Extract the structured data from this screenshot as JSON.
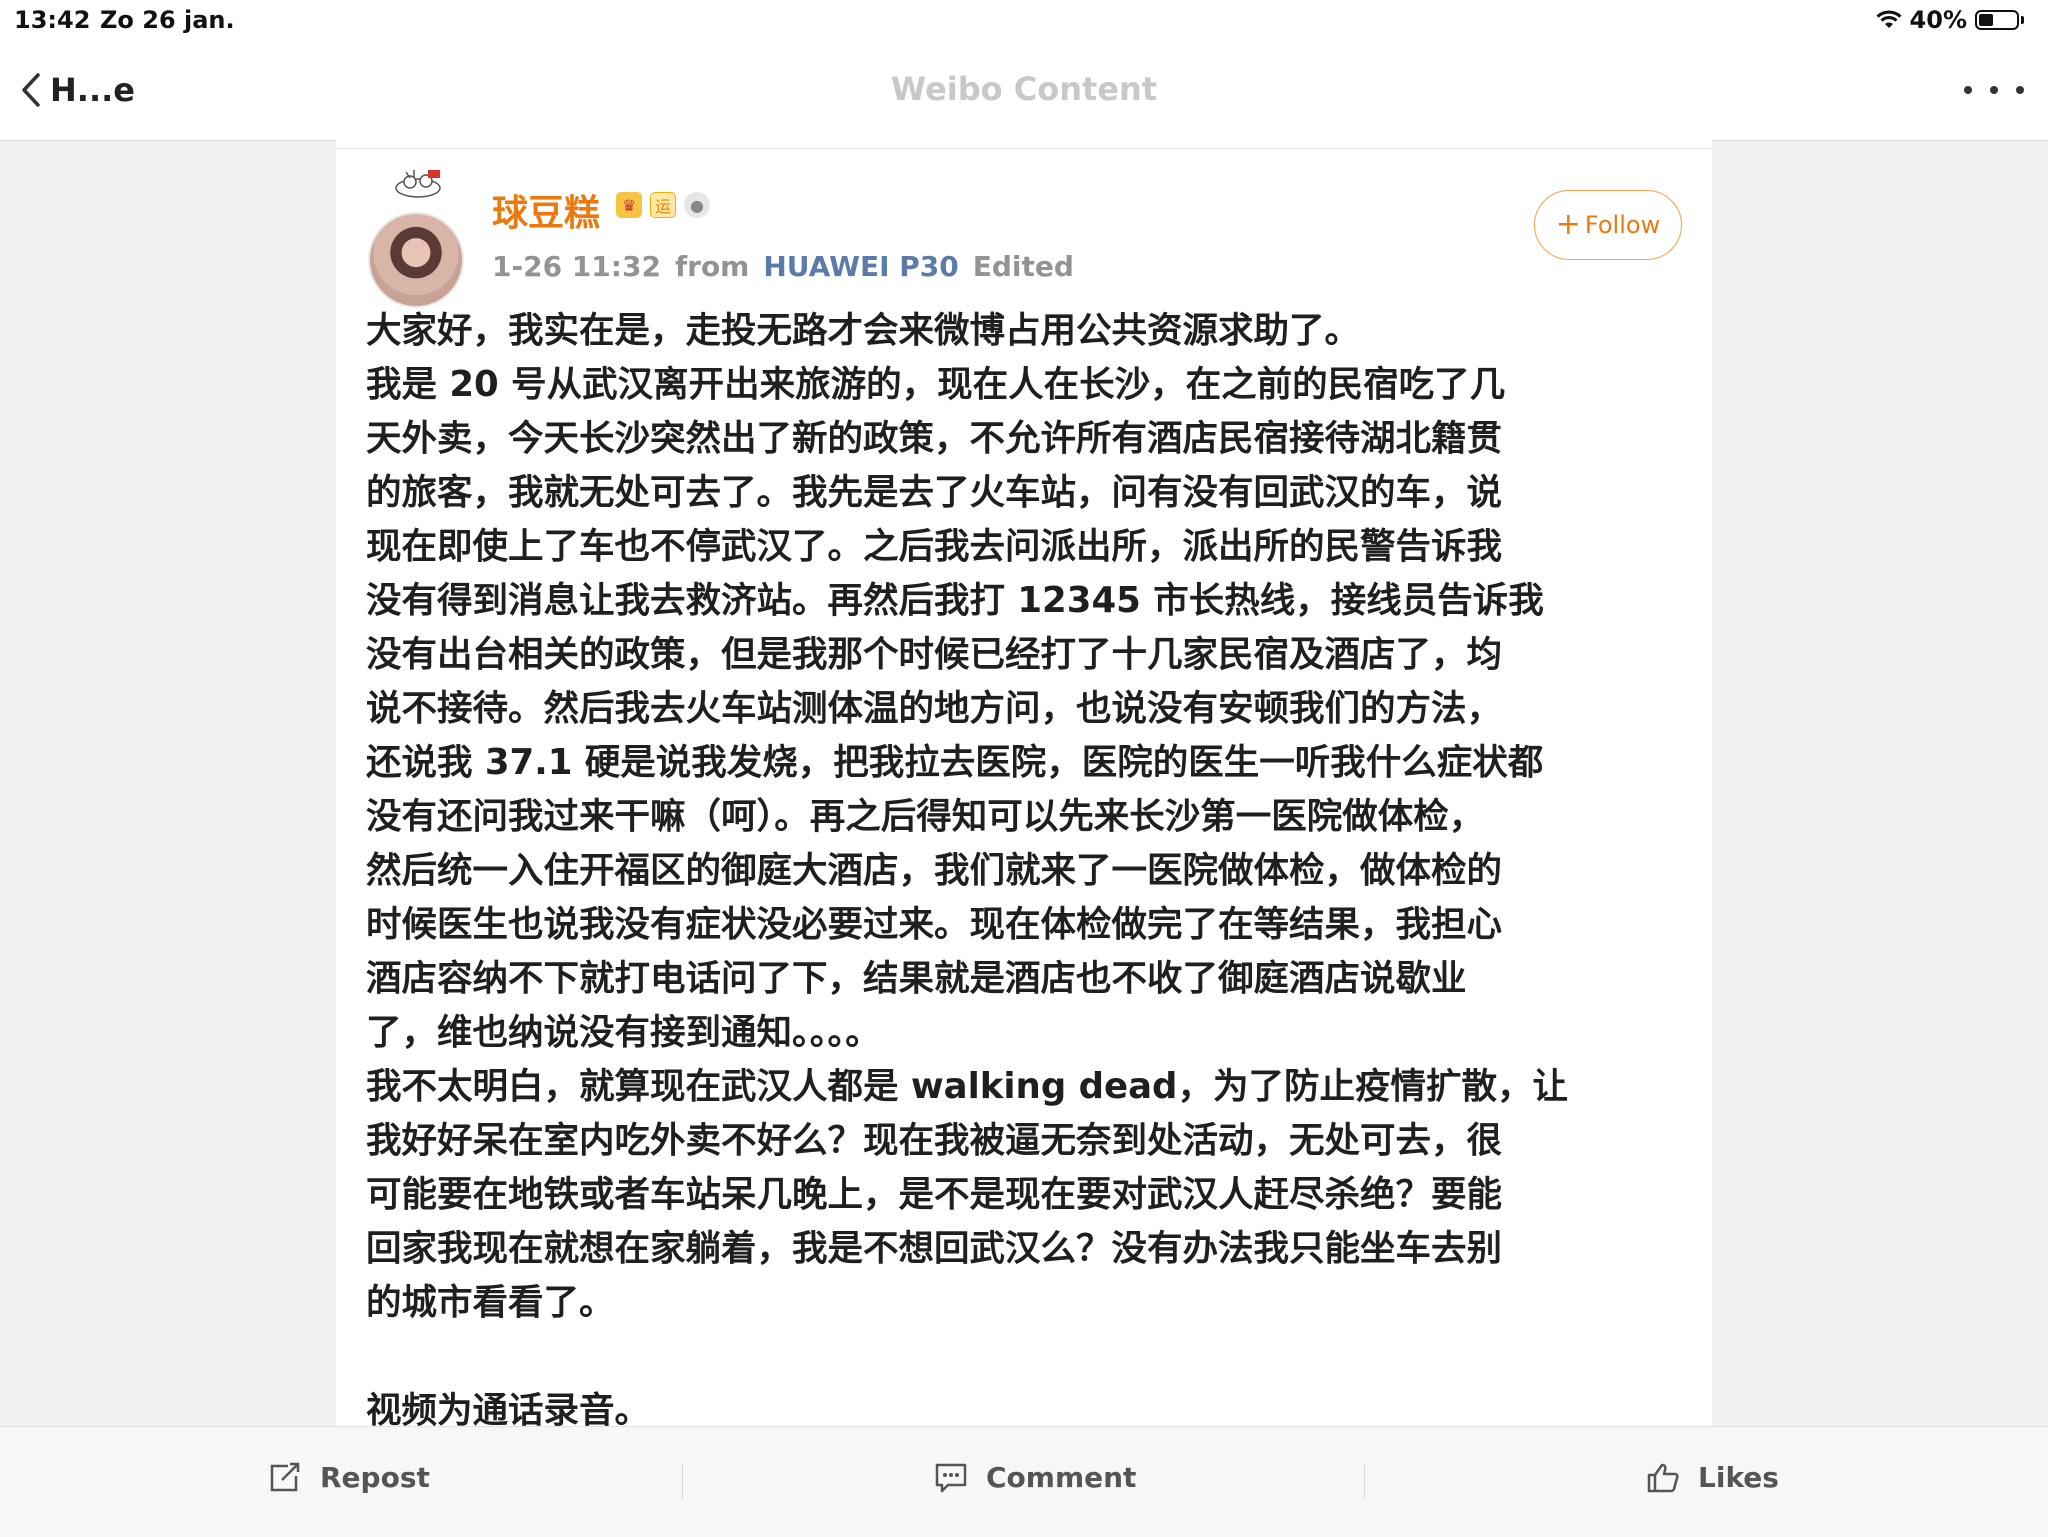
{
  "status_bar": {
    "time": "13:42",
    "date": "Zo 26 jan.",
    "battery": "40%",
    "battery_level": 0.4
  },
  "nav": {
    "back_label": "H...e",
    "title": "Weibo Content"
  },
  "post": {
    "username": "球豆糕",
    "badges": [
      "crown-badge",
      "vote-badge",
      "medal-badge"
    ],
    "badge_text": {
      "vote": "运"
    },
    "timestamp": "1-26 11:32",
    "from_label": "from",
    "device": "HUAWEI P30",
    "edited": "Edited",
    "follow_label": "Follow",
    "body_lines": [
      "大家好，我实在是，走投无路才会来微博占用公共资源求助了。",
      "我是 20 号从武汉离开出来旅游的，现在人在长沙，在之前的民宿吃了几",
      "天外卖，今天长沙突然出了新的政策，不允许所有酒店民宿接待湖北籍贯",
      "的旅客，我就无处可去了。我先是去了火车站，问有没有回武汉的车，说",
      "现在即使上了车也不停武汉了。之后我去问派出所，派出所的民警告诉我",
      "没有得到消息让我去救济站。再然后我打 12345 市长热线，接线员告诉我",
      "没有出台相关的政策，但是我那个时候已经打了十几家民宿及酒店了，均",
      "说不接待。然后我去火车站测体温的地方问，也说没有安顿我们的方法，",
      "还说我 37.1 硬是说我发烧，把我拉去医院，医院的医生一听我什么症状都",
      "没有还问我过来干嘛（呵）。再之后得知可以先来长沙第一医院做体检，",
      "然后统一入住开福区的御庭大酒店，我们就来了一医院做体检，做体检的",
      "时候医生也说我没有症状没必要过来。现在体检做完了在等结果，我担心",
      "酒店容纳不下就打电话问了下，结果就是酒店也不收了御庭酒店说歇业",
      "了，维也纳说没有接到通知。。。。",
      "我不太明白，就算现在武汉人都是 walking dead，为了防止疫情扩散，让",
      "我好好呆在室内吃外卖不好么？现在我被逼无奈到处活动，无处可去，很",
      "可能要在地铁或者车站呆几晚上，是不是现在要对武汉人赶尽杀绝？要能",
      "回家我现在就想在家躺着，我是不想回武汉么？没有办法我只能坐车去别",
      "的城市看看了。",
      "",
      "视频为通话录音。"
    ]
  },
  "actions": {
    "repost": "Repost",
    "comment": "Comment",
    "likes": "Likes"
  },
  "colors": {
    "username": "#eb7a0e",
    "device_link": "#5b7ba8",
    "follow_border": "#f3a04d",
    "nav_title": "#c8c8c8"
  }
}
